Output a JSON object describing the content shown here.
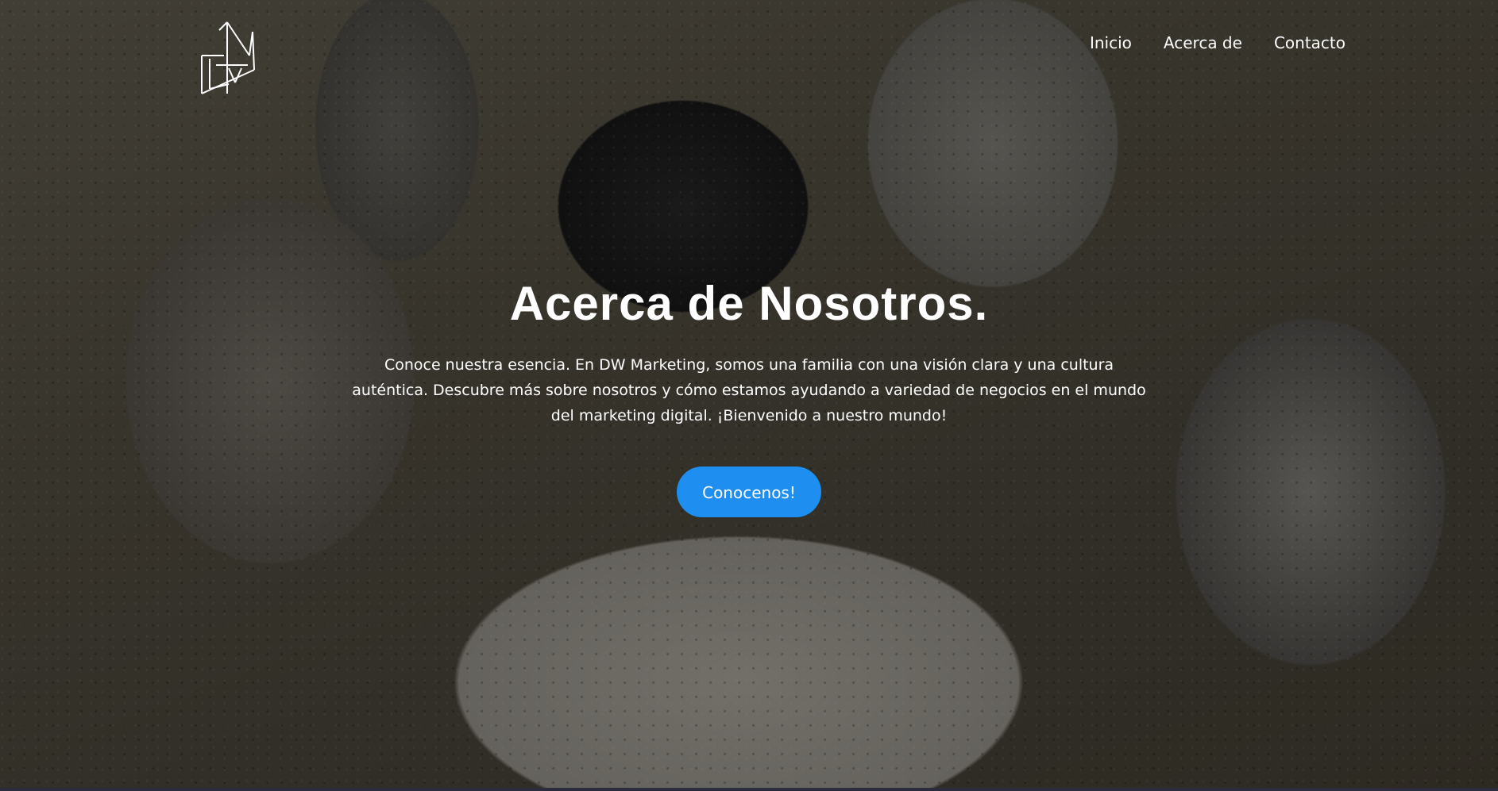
{
  "logo": {
    "alt_icon": "dw-marketing-logo",
    "letters": "DW"
  },
  "nav": {
    "items": [
      {
        "label": "Inicio"
      },
      {
        "label": "Acerca de"
      },
      {
        "label": "Contacto"
      }
    ]
  },
  "hero": {
    "title": "Acerca de Nosotros.",
    "description": "Conoce nuestra esencia. En DW Marketing, somos una familia con una visión clara y una cultura auténtica. Descubre más sobre nosotros y cómo estamos ayudando a variedad de negocios en el mundo del marketing digital. ¡Bienvenido a nuestro mundo!",
    "button_label": "Conocenos!"
  },
  "colors": {
    "accent": "#1e8ef0",
    "text": "#ffffff",
    "footer_bar": "#2b2d3a"
  }
}
